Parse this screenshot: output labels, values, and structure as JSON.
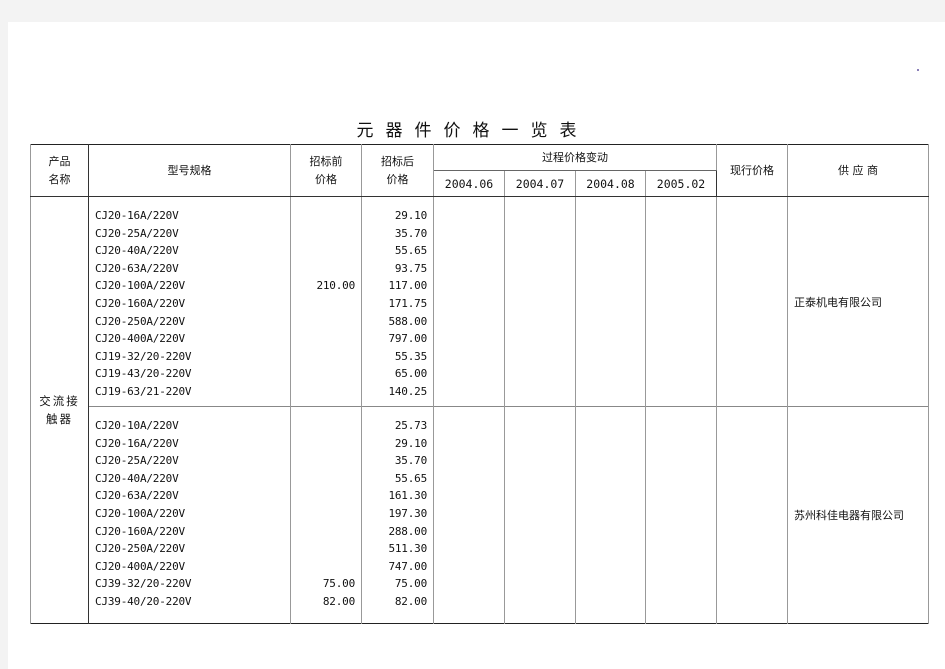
{
  "document": {
    "title": "元器件价格一览表"
  },
  "table": {
    "headers": {
      "product_name": "产品\n名称",
      "product_name_line1": "产品",
      "product_name_line2": "名称",
      "model_spec": "型号规格",
      "pre_bid_price_line1": "招标前",
      "pre_bid_price_line2": "价格",
      "post_bid_price_line1": "招标后",
      "post_bid_price_line2": "价格",
      "process_price_change": "过程价格变动",
      "periods": [
        "2004.06",
        "2004.07",
        "2004.08",
        "2005.02"
      ],
      "current_price": "现行价格",
      "supplier": "供 应 商"
    },
    "category": {
      "line1": "交流接",
      "line2": "触器"
    },
    "groups": [
      {
        "supplier": "正泰机电有限公司",
        "rows": [
          {
            "model": "CJ20-16A/220V",
            "pre_bid": "",
            "post_bid": "29.10"
          },
          {
            "model": "CJ20-25A/220V",
            "pre_bid": "",
            "post_bid": "35.70"
          },
          {
            "model": "CJ20-40A/220V",
            "pre_bid": "",
            "post_bid": "55.65"
          },
          {
            "model": "CJ20-63A/220V",
            "pre_bid": "",
            "post_bid": "93.75"
          },
          {
            "model": "CJ20-100A/220V",
            "pre_bid": "210.00",
            "post_bid": "117.00"
          },
          {
            "model": "CJ20-160A/220V",
            "pre_bid": "",
            "post_bid": "171.75"
          },
          {
            "model": "CJ20-250A/220V",
            "pre_bid": "",
            "post_bid": "588.00"
          },
          {
            "model": "CJ20-400A/220V",
            "pre_bid": "",
            "post_bid": "797.00"
          },
          {
            "model": "CJ19-32/20-220V",
            "pre_bid": "",
            "post_bid": "55.35"
          },
          {
            "model": "CJ19-43/20-220V",
            "pre_bid": "",
            "post_bid": "65.00"
          },
          {
            "model": "CJ19-63/21-220V",
            "pre_bid": "",
            "post_bid": "140.25"
          }
        ]
      },
      {
        "supplier": "苏州科佳电器有限公司",
        "rows": [
          {
            "model": "CJ20-10A/220V",
            "pre_bid": "",
            "post_bid": "25.73"
          },
          {
            "model": "CJ20-16A/220V",
            "pre_bid": "",
            "post_bid": "29.10"
          },
          {
            "model": "CJ20-25A/220V",
            "pre_bid": "",
            "post_bid": "35.70"
          },
          {
            "model": "CJ20-40A/220V",
            "pre_bid": "",
            "post_bid": "55.65"
          },
          {
            "model": "CJ20-63A/220V",
            "pre_bid": "",
            "post_bid": "161.30"
          },
          {
            "model": "CJ20-100A/220V",
            "pre_bid": "",
            "post_bid": "197.30"
          },
          {
            "model": "CJ20-160A/220V",
            "pre_bid": "",
            "post_bid": "288.00"
          },
          {
            "model": "CJ20-250A/220V",
            "pre_bid": "",
            "post_bid": "511.30"
          },
          {
            "model": "CJ20-400A/220V",
            "pre_bid": "",
            "post_bid": "747.00"
          },
          {
            "model": "CJ39-32/20-220V",
            "pre_bid": "75.00",
            "post_bid": "75.00"
          },
          {
            "model": "CJ39-40/20-220V",
            "pre_bid": "82.00",
            "post_bid": "82.00"
          }
        ]
      }
    ]
  }
}
